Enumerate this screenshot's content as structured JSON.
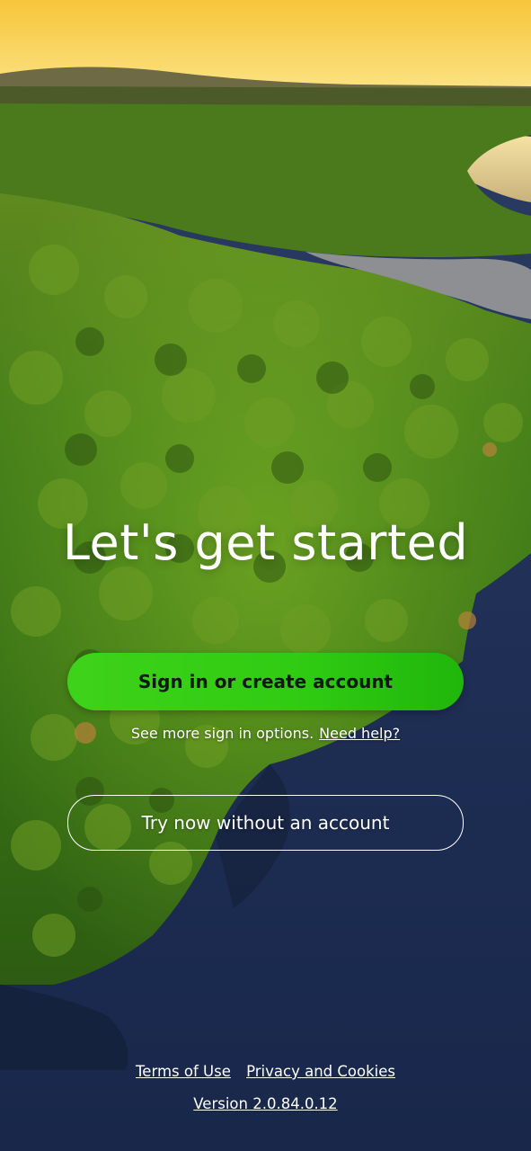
{
  "heading": "Let's get started",
  "primary_button": "Sign in or create account",
  "options_text": "See more sign in options.",
  "help_link": "Need help?",
  "secondary_button": "Try now without an account",
  "footer": {
    "terms": "Terms of Use",
    "privacy": "Privacy and Cookies",
    "version": "Version 2.0.84.0.12"
  },
  "colors": {
    "primary_button": "#2fcb12",
    "primary_button_text": "#0f1a0f",
    "text": "#ffffff"
  }
}
